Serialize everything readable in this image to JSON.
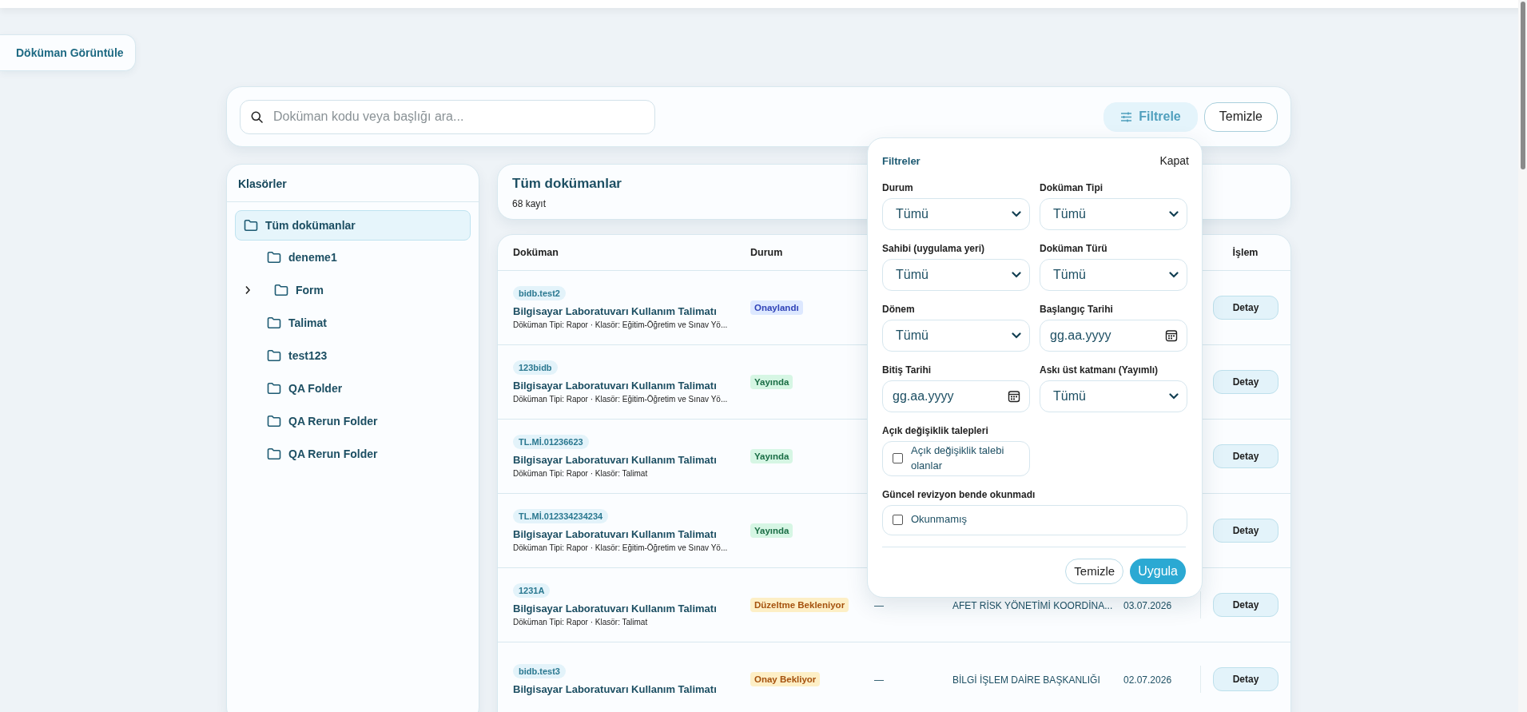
{
  "nav_tab": {
    "label": "Döküman Görüntüle"
  },
  "search": {
    "placeholder": "Doküman kodu veya başlığı ara..."
  },
  "toolbar": {
    "filter_button": {
      "label": "Filtrele",
      "active": true
    },
    "clear_button": {
      "label": "Temizle"
    }
  },
  "folders": {
    "title": "Klasörler",
    "items": [
      {
        "label": "Tüm dokümanlar",
        "selected": true,
        "children": [
          {
            "label": "deneme1",
            "selected": false
          },
          {
            "label": "Form",
            "selected": false,
            "expandable": true,
            "expanded": false
          },
          {
            "label": "Talimat",
            "selected": false
          },
          {
            "label": "test123",
            "selected": false
          },
          {
            "label": "QA Folder",
            "selected": false
          },
          {
            "label": "QA Rerun Folder",
            "selected": false
          },
          {
            "label": "QA Rerun Folder",
            "selected": false
          }
        ]
      }
    ]
  },
  "list_header": {
    "title": "Tüm dokümanlar",
    "count": "68 kayıt"
  },
  "table": {
    "columns": {
      "document": "Doküman",
      "status": "Durum",
      "action": "İşlem"
    },
    "rows": [
      {
        "code": "bidb.test2",
        "title": "Bilgisayar Laboratuvarı Kullanım Talimatı",
        "meta": "Döküman Tipi: Rapor · Klasör: Eğitim-Öğretim ve Sınav Yö...",
        "status": {
          "label": "Onaylandı",
          "kind": "approved"
        },
        "action": "Detay"
      },
      {
        "code": "123bidb",
        "title": "Bilgisayar Laboratuvarı Kullanım Talimatı",
        "meta": "Döküman Tipi: Rapor · Klasör: Eğitim-Öğretim ve Sınav Yö...",
        "status": {
          "label": "Yayında",
          "kind": "published"
        },
        "action": "Detay"
      },
      {
        "code": "TL.Mİ.01236623",
        "title": "Bilgisayar Laboratuvarı Kullanım Talimatı",
        "meta": "Döküman Tipi: Rapor · Klasör: Talimat",
        "status": {
          "label": "Yayında",
          "kind": "published"
        },
        "action": "Detay"
      },
      {
        "code": "TL.Mİ.012334234234",
        "title": "Bilgisayar Laboratuvarı Kullanım Talimatı",
        "meta": "Döküman Tipi: Rapor · Klasör: Eğitim-Öğretim ve Sınav Yö...",
        "status": {
          "label": "Yayında",
          "kind": "published"
        },
        "action": "Detay"
      },
      {
        "code": "1231A",
        "title": "Bilgisayar Laboratuvarı Kullanım Talimatı",
        "meta": "Döküman Tipi: Rapor · Klasör: Talimat",
        "status": {
          "label": "Düzeltme Bekleniyor",
          "kind": "revision"
        },
        "column_3": "—",
        "place": "AFET RİSK YÖNETİMİ KOORDİNA...",
        "date": "03.07.2026",
        "action": "Detay"
      },
      {
        "code": "bidb.test3",
        "title": "Bilgisayar Laboratuvarı Kullanım Talimatı",
        "status": {
          "label": "Onay Bekliyor",
          "kind": "pending"
        },
        "column_3": "—",
        "place": "BİLGİ İŞLEM DAİRE BAŞKANLIĞI",
        "date": "02.07.2026",
        "action": "Detay"
      }
    ]
  },
  "filter_panel": {
    "title": "Filtreler",
    "close": "Kapat",
    "fields": [
      {
        "kind": "select",
        "label": "Durum",
        "value": "Tümü"
      },
      {
        "kind": "select",
        "label": "Doküman Tipi",
        "value": "Tümü"
      },
      {
        "kind": "select",
        "label": "Sahibi (uygulama yeri)",
        "value": "Tümü"
      },
      {
        "kind": "select",
        "label": "Doküman Türü",
        "value": "Tümü"
      },
      {
        "kind": "select",
        "label": "Dönem",
        "value": "Tümü"
      },
      {
        "kind": "date",
        "label": "Başlangıç Tarihi",
        "placeholder": "gg.aa.yyyy"
      },
      {
        "kind": "date",
        "label": "Bitiş Tarihi",
        "placeholder": "gg.aa.yyyy"
      },
      {
        "kind": "select",
        "label": "Askı üst katmanı (Yayımlı)",
        "value": "Tümü"
      },
      {
        "kind": "checkbox",
        "label": "Açık değişiklik talepleri",
        "option": "Açık değişiklik talebi olanlar",
        "checked": false
      },
      {
        "kind": "checkbox",
        "label": "Güncel revizyon bende okunmadı",
        "option": "Okunmamış",
        "checked": false,
        "wide": true
      }
    ],
    "clear_button": "Temizle",
    "apply_button": "Uygula"
  }
}
